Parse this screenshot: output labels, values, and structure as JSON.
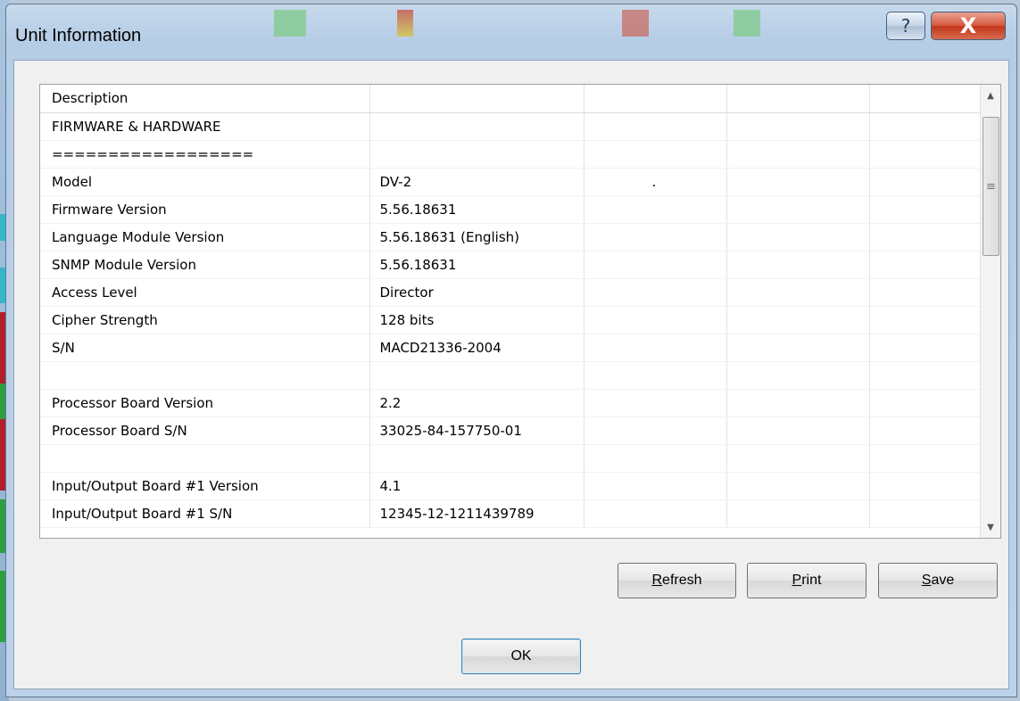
{
  "window": {
    "title": "Unit Information",
    "help_glyph": "?",
    "close_glyph": "X"
  },
  "table": {
    "header": "Description",
    "rows": [
      [
        "FIRMWARE & HARDWARE",
        ""
      ],
      [
        "==================",
        ""
      ],
      [
        "Model",
        "DV-2"
      ],
      [
        "Firmware Version",
        "5.56.18631"
      ],
      [
        "Language Module Version",
        "5.56.18631 (English)"
      ],
      [
        "SNMP Module Version",
        "5.56.18631"
      ],
      [
        "Access Level",
        "Director"
      ],
      [
        "Cipher Strength",
        "128 bits"
      ],
      [
        "S/N",
        "MACD21336-2004"
      ],
      [
        "",
        ""
      ],
      [
        "Processor Board Version",
        "2.2"
      ],
      [
        "Processor Board S/N",
        "33025-84-157750-01"
      ],
      [
        "",
        ""
      ],
      [
        "Input/Output Board #1 Version",
        "4.1"
      ],
      [
        "Input/Output Board #1 S/N",
        "12345-12-1211439789"
      ]
    ],
    "model_dot": "."
  },
  "scrollbar": {
    "up_glyph": "▲",
    "down_glyph": "▼",
    "thumb_grip": "≡"
  },
  "buttons": {
    "refresh": {
      "mnemonic": "R",
      "rest": "efresh"
    },
    "print": {
      "mnemonic": "P",
      "rest": "rint"
    },
    "save": {
      "mnemonic": "S",
      "rest": "ave"
    },
    "ok": "OK"
  },
  "colors": {
    "accent": "#3c7fb1",
    "close": "#c2361b",
    "title_bg": "#c7d9ec"
  }
}
